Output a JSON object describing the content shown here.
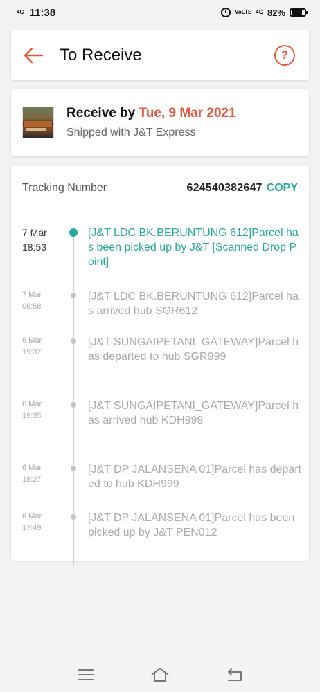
{
  "status_bar": {
    "network_left": "4G",
    "time": "11:38",
    "network_right_1": "VoLTE",
    "network_right_2": "4G",
    "battery": "82%"
  },
  "header": {
    "title": "To Receive"
  },
  "delivery": {
    "receive_prefix": "Receive by ",
    "receive_date": "Tue, 9 Mar 2021",
    "shipped_with": "Shipped with J&T Express"
  },
  "tracking": {
    "label": "Tracking Number",
    "number": "624540382647",
    "copy_label": "COPY",
    "events": [
      {
        "date": "7 Mar",
        "time": "18:53",
        "text": "[J&T LDC BK.BERUNTUNG 612]Parcel has been picked up by J&T [Scanned Drop Point]"
      },
      {
        "date": "7 Mar",
        "time": "06:58",
        "text": "[J&T LDC BK.BERUNTUNG 612]Parcel has arrived hub SGR612"
      },
      {
        "date": "6 Mar",
        "time": "19:37",
        "text": "[J&T SUNGAIPETANI_GATEWAY]Parcel has departed to hub SGR999"
      },
      {
        "date": "6 Mar",
        "time": "19:35",
        "text": "[J&T SUNGAIPETANI_GATEWAY]Parcel has arrived hub KDH999"
      },
      {
        "date": "6 Mar",
        "time": "18:27",
        "text": "[J&T DP JALANSENA 01]Parcel has departed to hub KDH999"
      },
      {
        "date": "6 Mar",
        "time": "17:49",
        "text": "[J&T DP JALANSENA 01]Parcel has been picked up by J&T PEN012"
      }
    ]
  },
  "colors": {
    "accent": "#e5553a",
    "teal": "#26aa99"
  }
}
